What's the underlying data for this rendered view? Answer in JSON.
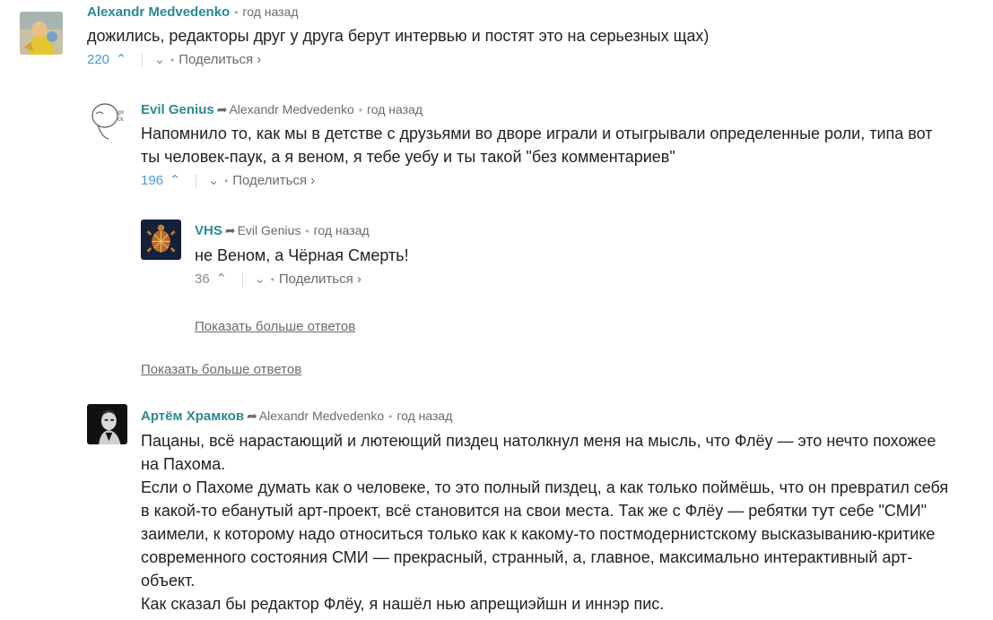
{
  "comments": [
    {
      "author": "Alexandr Medvedenko",
      "reply_to": "",
      "time": "год назад",
      "text": [
        "дожились, редакторы друг у друга берут интервью и постят это на серьезных щах)"
      ],
      "votes": "220",
      "share_label": "Поделиться ›"
    },
    {
      "author": "Evil Genius",
      "reply_to": "Alexandr Medvedenko",
      "time": "год назад",
      "text": [
        "Напомнило то, как мы в детстве с друзьями во дворе играли и отыгрывали определенные роли, типа вот ты человек-паук, а я веном, я тебе уебу и ты такой \"без комментариев\""
      ],
      "votes": "196",
      "share_label": "Поделиться ›"
    },
    {
      "author": "VHS",
      "reply_to": "Evil Genius",
      "time": "год назад",
      "text": [
        "не Веном, а Чёрная Смерть!"
      ],
      "votes": "36",
      "share_label": "Поделиться ›"
    },
    {
      "author": "Артём Храмков",
      "reply_to": "Alexandr Medvedenko",
      "time": "год назад",
      "text": [
        "Пацаны, всё нарастающий и лютеющий пиздец натолкнул меня на мысль, что Флёу — это нечто похожее на Пахома.",
        "Если о Пахоме думать как о человеке, то это полный пиздец, а как только поймёшь, что он превратил себя в какой-то ебанутый арт-проект, всё становится на свои места. Так же с Флёу — ребятки тут себе \"СМИ\" заимели, к которому надо относиться только как к какому-то постмодернистскому высказыванию-критике современного состояния СМИ — прекрасный, странный, а, главное, максимально интерактивный арт-объект.",
        "Как сказал бы редактор Флёу, я нашёл нью апрещиэйшн и иннэр пис."
      ]
    }
  ],
  "show_more_label": "Показать больше ответов",
  "icons": {
    "reply_arrow": "reply-arrow-icon",
    "upvote": "chevron-up-icon",
    "downvote": "chevron-down-icon"
  },
  "colors": {
    "author": "#2a8a8f",
    "votes_highlight": "#4a9bd1",
    "meta": "#6b6b6b"
  }
}
